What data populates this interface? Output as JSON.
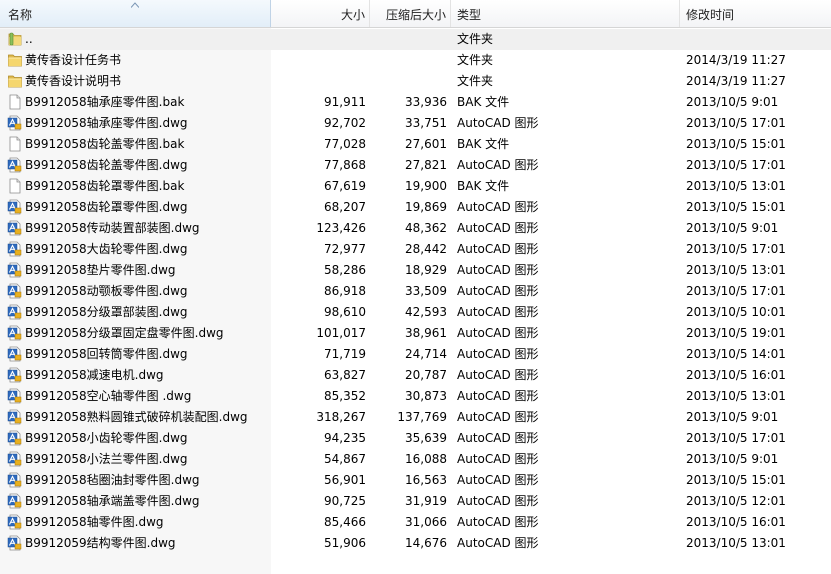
{
  "columns": {
    "name": "名称",
    "size": "大小",
    "compressed": "压缩后大小",
    "type": "类型",
    "modified": "修改时间"
  },
  "files": [
    {
      "name": "..",
      "size": "",
      "compressed": "",
      "type": "文件夹",
      "modified": "",
      "icon": "folder-up-icon",
      "kind": "up"
    },
    {
      "name": "黄传香设计任务书",
      "size": "",
      "compressed": "",
      "type": "文件夹",
      "modified": "2014/3/19 11:27",
      "icon": "folder-icon",
      "kind": "folder"
    },
    {
      "name": "黄传香设计说明书",
      "size": "",
      "compressed": "",
      "type": "文件夹",
      "modified": "2014/3/19 11:27",
      "icon": "folder-icon",
      "kind": "folder"
    },
    {
      "name": "B9912058轴承座零件图.bak",
      "size": "91,911",
      "compressed": "33,936",
      "type": "BAK 文件",
      "modified": "2013/10/5 9:01",
      "icon": "blank-file-icon",
      "kind": "bak"
    },
    {
      "name": "B9912058轴承座零件图.dwg",
      "size": "92,702",
      "compressed": "33,751",
      "type": "AutoCAD 图形",
      "modified": "2013/10/5 17:01",
      "icon": "autocad-file-icon",
      "kind": "dwg"
    },
    {
      "name": "B9912058齿轮盖零件图.bak",
      "size": "77,028",
      "compressed": "27,601",
      "type": "BAK 文件",
      "modified": "2013/10/5 15:01",
      "icon": "blank-file-icon",
      "kind": "bak"
    },
    {
      "name": "B9912058齿轮盖零件图.dwg",
      "size": "77,868",
      "compressed": "27,821",
      "type": "AutoCAD 图形",
      "modified": "2013/10/5 17:01",
      "icon": "autocad-file-icon",
      "kind": "dwg"
    },
    {
      "name": "B9912058齿轮罩零件图.bak",
      "size": "67,619",
      "compressed": "19,900",
      "type": "BAK 文件",
      "modified": "2013/10/5 13:01",
      "icon": "blank-file-icon",
      "kind": "bak"
    },
    {
      "name": "B9912058齿轮罩零件图.dwg",
      "size": "68,207",
      "compressed": "19,869",
      "type": "AutoCAD 图形",
      "modified": "2013/10/5 15:01",
      "icon": "autocad-file-icon",
      "kind": "dwg"
    },
    {
      "name": "B9912058传动装置部装图.dwg",
      "size": "123,426",
      "compressed": "48,362",
      "type": "AutoCAD 图形",
      "modified": "2013/10/5 9:01",
      "icon": "autocad-file-icon",
      "kind": "dwg"
    },
    {
      "name": "B9912058大齿轮零件图.dwg",
      "size": "72,977",
      "compressed": "28,442",
      "type": "AutoCAD 图形",
      "modified": "2013/10/5 17:01",
      "icon": "autocad-file-icon",
      "kind": "dwg"
    },
    {
      "name": "B9912058垫片零件图.dwg",
      "size": "58,286",
      "compressed": "18,929",
      "type": "AutoCAD 图形",
      "modified": "2013/10/5 13:01",
      "icon": "autocad-file-icon",
      "kind": "dwg"
    },
    {
      "name": "B9912058动颚板零件图.dwg",
      "size": "86,918",
      "compressed": "33,509",
      "type": "AutoCAD 图形",
      "modified": "2013/10/5 17:01",
      "icon": "autocad-file-icon",
      "kind": "dwg"
    },
    {
      "name": "B9912058分级罩部装图.dwg",
      "size": "98,610",
      "compressed": "42,593",
      "type": "AutoCAD 图形",
      "modified": "2013/10/5 10:01",
      "icon": "autocad-file-icon",
      "kind": "dwg"
    },
    {
      "name": "B9912058分级罩固定盘零件图.dwg",
      "size": "101,017",
      "compressed": "38,961",
      "type": "AutoCAD 图形",
      "modified": "2013/10/5 19:01",
      "icon": "autocad-file-icon",
      "kind": "dwg"
    },
    {
      "name": "B9912058回转筒零件图.dwg",
      "size": "71,719",
      "compressed": "24,714",
      "type": "AutoCAD 图形",
      "modified": "2013/10/5 14:01",
      "icon": "autocad-file-icon",
      "kind": "dwg"
    },
    {
      "name": "B9912058减速电机.dwg",
      "size": "63,827",
      "compressed": "20,787",
      "type": "AutoCAD 图形",
      "modified": "2013/10/5 16:01",
      "icon": "autocad-file-icon",
      "kind": "dwg"
    },
    {
      "name": "B9912058空心轴零件图 .dwg",
      "size": "85,352",
      "compressed": "30,873",
      "type": "AutoCAD 图形",
      "modified": "2013/10/5 13:01",
      "icon": "autocad-file-icon",
      "kind": "dwg"
    },
    {
      "name": "B9912058熟料圆锥式破碎机装配图.dwg",
      "size": "318,267",
      "compressed": "137,769",
      "type": "AutoCAD 图形",
      "modified": "2013/10/5 9:01",
      "icon": "autocad-file-icon",
      "kind": "dwg"
    },
    {
      "name": "B9912058小齿轮零件图.dwg",
      "size": "94,235",
      "compressed": "35,639",
      "type": "AutoCAD 图形",
      "modified": "2013/10/5 17:01",
      "icon": "autocad-file-icon",
      "kind": "dwg"
    },
    {
      "name": "B9912058小法兰零件图.dwg",
      "size": "54,867",
      "compressed": "16,088",
      "type": "AutoCAD 图形",
      "modified": "2013/10/5 9:01",
      "icon": "autocad-file-icon",
      "kind": "dwg"
    },
    {
      "name": "B9912058毡圈油封零件图.dwg",
      "size": "56,901",
      "compressed": "16,563",
      "type": "AutoCAD 图形",
      "modified": "2013/10/5 15:01",
      "icon": "autocad-file-icon",
      "kind": "dwg"
    },
    {
      "name": "B9912058轴承端盖零件图.dwg",
      "size": "90,725",
      "compressed": "31,919",
      "type": "AutoCAD 图形",
      "modified": "2013/10/5 12:01",
      "icon": "autocad-file-icon",
      "kind": "dwg"
    },
    {
      "name": "B9912058轴零件图.dwg",
      "size": "85,466",
      "compressed": "31,066",
      "type": "AutoCAD 图形",
      "modified": "2013/10/5 16:01",
      "icon": "autocad-file-icon",
      "kind": "dwg"
    },
    {
      "name": "B9912059结构零件图.dwg",
      "size": "51,906",
      "compressed": "14,676",
      "type": "AutoCAD 图形",
      "modified": "2013/10/5 13:01",
      "icon": "autocad-file-icon",
      "kind": "dwg"
    }
  ]
}
